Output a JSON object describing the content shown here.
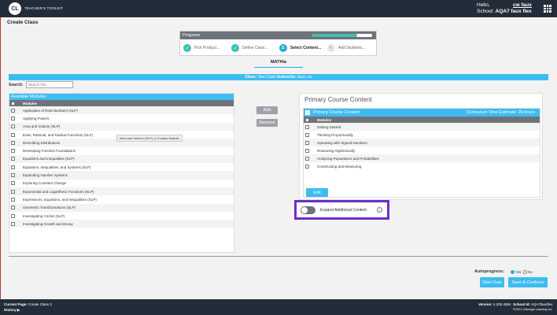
{
  "header": {
    "logo_text": "CL",
    "brand": "TEACHER'S TOOLKIT",
    "hello": "Hello,",
    "user": "cw faux",
    "school_label": "School:",
    "school": "AQA7 faux flex",
    "apps_icon": "grid-icon"
  },
  "page": {
    "title": "Create Class"
  },
  "progress": {
    "label": "Progress",
    "fraction": 0.75,
    "steps": [
      {
        "marker": "✓",
        "label": "Pick Product..."
      },
      {
        "marker": "✓",
        "label": "Define Class..."
      },
      {
        "marker": "3.",
        "label": "Select Content..."
      },
      {
        "marker": "4.",
        "label": "Add Students..."
      }
    ]
  },
  "product": {
    "name": "MATHia"
  },
  "class_bar": {
    "class_label": "Class:",
    "class_name": "Test Class",
    "instructor_label": "Instructor:",
    "instructor": "faux, cw"
  },
  "search": {
    "label": "Search:",
    "placeholder": "Search File..."
  },
  "available": {
    "title": "Available Modules",
    "column": "Modules",
    "items": [
      "Application of Real Numbers (SLP)",
      "Applying Powers",
      "Area and Volume (SLP)",
      "Euler, Rational, and Radical Functions (SLP)",
      "Describing Distributions",
      "Developing Function Foundations",
      "Equations and Inequalities (SLP)",
      "Equations, Inequalities, and Systems (SLP)",
      "Expanding Number Systems",
      "Exploring Constant Change",
      "Exponential and Logarithmic Functions (SLP)",
      "Expressions, Equations, and Inequalities (SLP)",
      "Geometric Transformations (SLP)",
      "Investigating Circles (SLP)",
      "Investigating Growth and Decay"
    ],
    "tooltip": "Area and Volume (SLP), a Custom Module"
  },
  "actions": {
    "add": "Add",
    "remove": "Remove"
  },
  "primary": {
    "title": "Primary Course Content",
    "collapse_icon": "minus-icon",
    "header": "Primary Course Content",
    "estimate": "Curriculum Time Estimate: 25 hours",
    "column": "Modules",
    "items": [
      "Getting Started",
      "Thinking Proportionally",
      "Operating with Signed Numbers",
      "Reasoning Algebraically",
      "Analyzing Populations and Probabilities",
      "Constructing and Measuring"
    ],
    "edit": "Edit"
  },
  "expand": {
    "label": "Expand Additional Content",
    "info_glyph": "i",
    "on": false
  },
  "autoprogress": {
    "label": "Autoprogress:",
    "yes": "Yes",
    "no": "No",
    "selected": "Yes"
  },
  "buttons": {
    "start_over": "Start Over",
    "save_continue": "Save & Continue"
  },
  "footer": {
    "current_label": "Current Page:",
    "current": "Create Class 3",
    "history": "History ▶",
    "version_label": "Version:",
    "version": "4.200.4584",
    "school_id_label": "School Id:",
    "school_id": "AQA7fauxflex",
    "copyright": "©2021 Carnegie Learning Inc"
  },
  "colors": {
    "accent": "#3dbcf1",
    "nav": "#232c39",
    "progress": "#3cc1b1",
    "highlight": "#6d2ec6"
  }
}
